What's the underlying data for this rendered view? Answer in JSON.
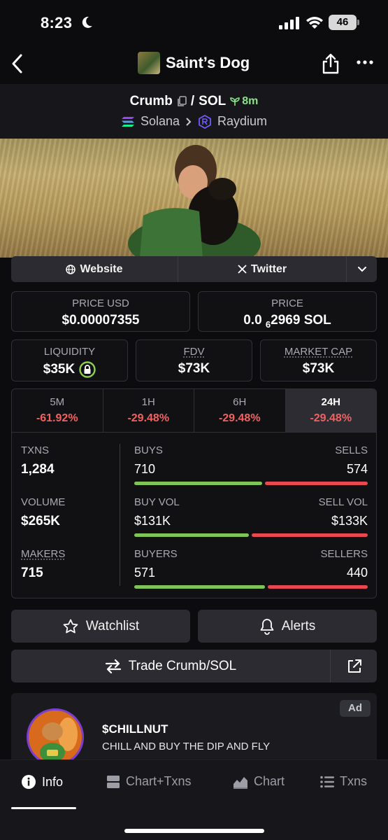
{
  "status": {
    "time": "8:23",
    "battery": "46"
  },
  "nav": {
    "title": "Saint’s Dog"
  },
  "pair": {
    "base": "Crumb",
    "separator": "/",
    "quote": "SOL",
    "age": "8m",
    "chain": "Solana",
    "dex": "Raydium"
  },
  "links": {
    "website": "Website",
    "twitter": "Twitter"
  },
  "price": {
    "usd_label": "PRICE USD",
    "usd_value": "$0.00007355",
    "native_label": "PRICE",
    "native_prefix": "0.0",
    "native_subscript": "6",
    "native_suffix": "2969 SOL"
  },
  "metrics": {
    "liquidity_label": "LIQUIDITY",
    "liquidity_value": "$35K",
    "fdv_label": "FDV",
    "fdv_value": "$73K",
    "mcap_label": "MARKET CAP",
    "mcap_value": "$73K"
  },
  "timeframes": [
    {
      "name": "5M",
      "change": "-61.92%"
    },
    {
      "name": "1H",
      "change": "-29.48%"
    },
    {
      "name": "6H",
      "change": "-29.48%"
    },
    {
      "name": "24H",
      "change": "-29.48%"
    }
  ],
  "stats": {
    "txns_label": "TXNS",
    "txns_value": "1,284",
    "volume_label": "VOLUME",
    "volume_value": "$265K",
    "makers_label": "MAKERS",
    "makers_value": "715",
    "buys_label": "BUYS",
    "buys_value": "710",
    "sells_label": "SELLS",
    "sells_value": "574",
    "buyvol_label": "BUY VOL",
    "buyvol_value": "$131K",
    "sellvol_label": "SELL VOL",
    "sellvol_value": "$133K",
    "buyers_label": "BUYERS",
    "buyers_value": "571",
    "sellers_label": "SELLERS",
    "sellers_value": "440",
    "buys_ratio": 0.553,
    "buyvol_ratio": 0.496,
    "buyers_ratio": 0.565
  },
  "actions": {
    "watchlist": "Watchlist",
    "alerts": "Alerts",
    "trade": "Trade Crumb/SOL"
  },
  "ad": {
    "badge": "Ad",
    "title": "$CHILLNUT",
    "text": "CHILL AND BUY THE DIP AND FLY"
  },
  "bottom_nav": {
    "info": "Info",
    "chart_txns": "Chart+Txns",
    "chart": "Chart",
    "txns": "Txns"
  },
  "colors": {
    "positive": "#7fc456",
    "negative": "#e8484f",
    "change_negative_text": "#f06161",
    "age_green": "#8be28b"
  }
}
